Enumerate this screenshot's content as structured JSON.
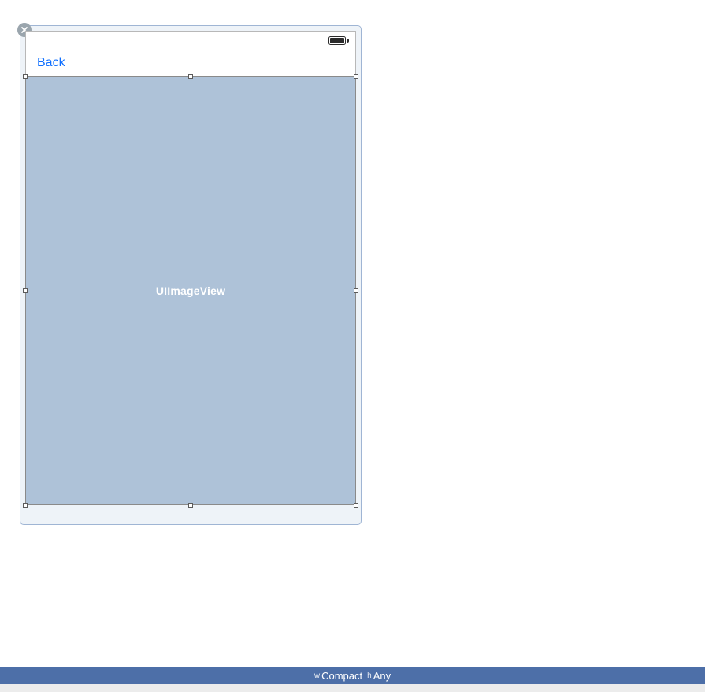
{
  "navbar": {
    "back_label": "Back"
  },
  "imageview": {
    "placeholder_text": "UIImageView"
  },
  "sizeclass": {
    "width_prefix": "w",
    "width_value": "Compact",
    "height_prefix": "h",
    "height_value": "Any"
  }
}
